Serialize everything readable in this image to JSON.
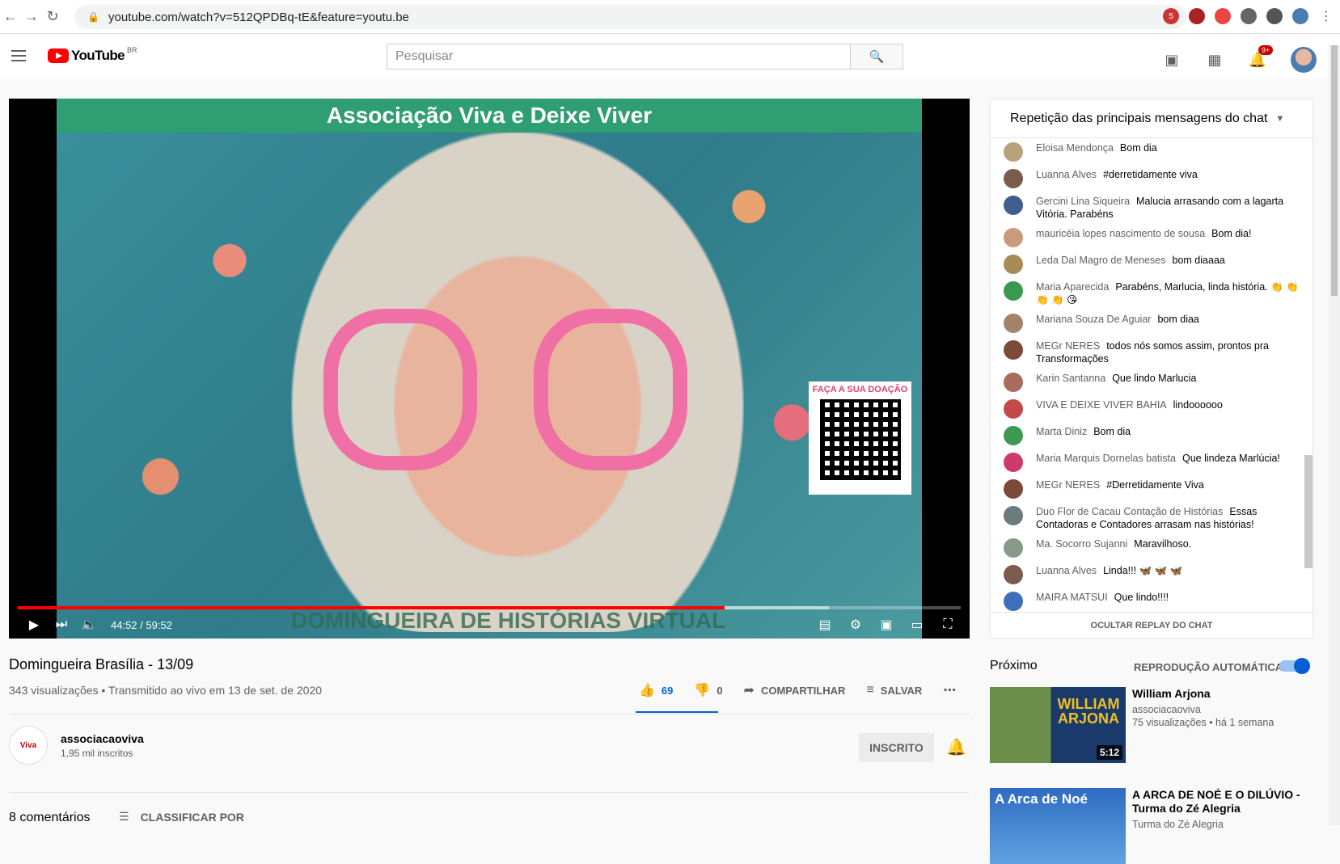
{
  "browser": {
    "url": "youtube.com/watch?v=512QPDBq-tE&feature=youtu.be",
    "ext_badge": "5"
  },
  "header": {
    "logo_text": "YouTube",
    "country": "BR",
    "search_placeholder": "Pesquisar",
    "notifications_badge": "9+"
  },
  "video": {
    "banner_text": "Associação Viva e Deixe Viver",
    "qr_title": "FAÇA A SUA DOAÇÃO",
    "footer_text": "DOMINGUEIRA DE HISTÓRIAS VIRTUAL",
    "time": "44:52 / 59:52",
    "progress_fraction": 0.7494,
    "title": "Domingueira Brasília - 13/09",
    "meta": "343 visualizações • Transmitido ao vivo em 13 de set. de 2020",
    "likes": "69",
    "dislikes": "0",
    "share_label": "COMPARTILHAR",
    "save_label": "SALVAR"
  },
  "channel": {
    "name": "associacaoviva",
    "subs": "1,95 mil inscritos",
    "subscribed_label": "INSCRITO"
  },
  "comments": {
    "count": "8 comentários",
    "sort_label": "CLASSIFICAR POR"
  },
  "chat": {
    "header": "Repetição das principais mensagens do chat",
    "footer": "OCULTAR REPLAY DO CHAT",
    "messages": [
      {
        "author": "Eloisa Mendonça",
        "text": "Bom dia",
        "color": "#b8a27a"
      },
      {
        "author": "Luanna Alves",
        "text": "#derretidamente viva",
        "color": "#7a5b4c"
      },
      {
        "author": "Gercini Lina Siqueira",
        "text": "Malucia arrasando com a lagarta Vitória. Parabéns",
        "color": "#3f5f8f"
      },
      {
        "author": "mauricéia lopes nascimento de sousa",
        "text": "Bom dia!",
        "color": "#c99a7c"
      },
      {
        "author": "Leda Dal Magro de Meneses",
        "text": "bom diaaaa",
        "color": "#a88b55"
      },
      {
        "author": "Maria Aparecida",
        "text": "Parabéns, Marlucia, linda história. 👏 👏 👏 👏 😘",
        "color": "#3b9a4f"
      },
      {
        "author": "Mariana Souza De Aguiar",
        "text": "bom diaa",
        "color": "#a4836b"
      },
      {
        "author": "MEGr NERES",
        "text": "todos nós somos assim, prontos pra Transformações",
        "color": "#7c4a3a"
      },
      {
        "author": "Karin Santanna",
        "text": "Que lindo Marlucia",
        "color": "#a86b5e"
      },
      {
        "author": "VIVA E DEIXE VIVER BAHIA",
        "text": "lindoooooo",
        "color": "#c44a4a"
      },
      {
        "author": "Marta Diniz",
        "text": "Bom dia",
        "color": "#3b9a4f"
      },
      {
        "author": "Maria Marquis Dornelas batista",
        "text": "Que lindeza Marlúcia!",
        "color": "#d0396b"
      },
      {
        "author": "MEGr NERES",
        "text": "#Derretidamente Viva",
        "color": "#7c4a3a"
      },
      {
        "author": "Duo Flor de Cacau Contação de Histórias",
        "text": "Essas Contadoras e Contadores arrasam nas histórias!",
        "color": "#6b7a7a"
      },
      {
        "author": "Ma. Socorro Sujanni",
        "text": "Maravilhoso.",
        "color": "#8a9a8a"
      },
      {
        "author": "Luanna Alves",
        "text": "Linda!!! 🦋 🦋 🦋",
        "color": "#7a5b4c"
      },
      {
        "author": "MAIRA MATSUI",
        "text": "Que lindo!!!!",
        "color": "#3f6fb8"
      }
    ]
  },
  "next": {
    "title": "Próximo",
    "autoplay_label": "REPRODUÇÃO AUTOMÁTICA",
    "items": [
      {
        "title": "William Arjona",
        "channel": "associacaoviva",
        "meta": "75 visualizações • há 1 semana",
        "duration": "5:12",
        "thumb_text": "WILLIAM ARJONA"
      },
      {
        "title": "A ARCA DE NOÉ E O DILÚVIO - Turma do Zé Alegria",
        "channel": "Turma do Zé Alegria",
        "meta": "",
        "duration": "",
        "thumb_text": "A Arca de Noé"
      }
    ]
  }
}
